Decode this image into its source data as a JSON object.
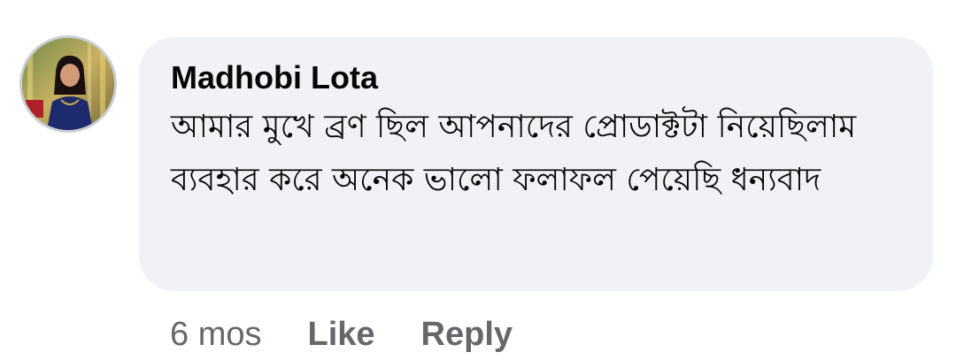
{
  "comment": {
    "author": "Madhobi Lota",
    "text": "আমার মুখে ব্রণ ছিল আপনাদের প্রোডাক্টটা নিয়েছিলাম ব্যবহার করে অনেক ভালো ফলাফল পেয়েছি ধন্যবাদ",
    "avatar": "profile-photo"
  },
  "actions": {
    "time": "6 mos",
    "like_label": "Like",
    "reply_label": "Reply"
  },
  "colors": {
    "bubble_bg": "#f0f2f5",
    "meta_text": "#65676b",
    "primary_text": "#050505"
  }
}
